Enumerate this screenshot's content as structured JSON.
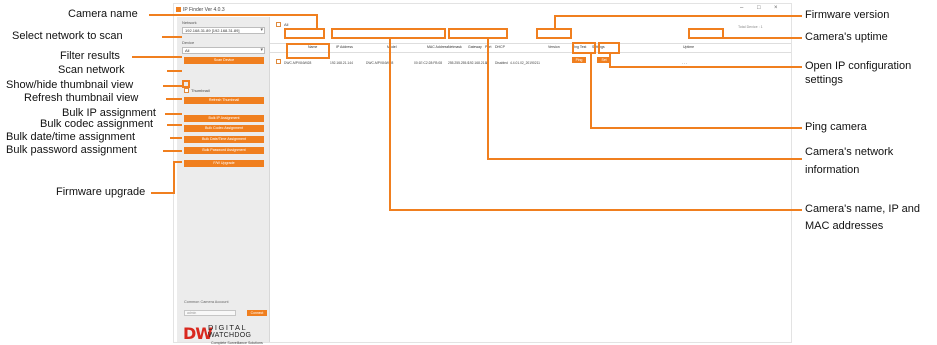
{
  "window": {
    "title": "IP Finder Ver 4.0.3",
    "controls": [
      "–",
      "□",
      "×"
    ]
  },
  "sidebar": {
    "network_label": "Network",
    "network_value": "192.168.31.89 [192.168.31.89]",
    "device_label": "Device",
    "device_value": "All",
    "scan_button": "Scan Device",
    "thumbnail_label": "Thumbnail",
    "refresh_button": "Refresh Thumbnail",
    "bulk_buttons": [
      "Bulk IP Assignment",
      "Bulk Codec Assignment",
      "Bulk Date/Time Assignment",
      "Bulk Password Assignment",
      "F/W Upgrade"
    ],
    "connect_label": "Common Camera Account",
    "connect_placeholder": "admin",
    "connect_button": "Connect",
    "logo": {
      "dw": "DW",
      "line1": "DIGITAL",
      "line2": "WATCHDOG",
      "tagline": "Complete Surveillance Solutions"
    }
  },
  "table": {
    "all_label": "All",
    "total_label": "Total Device : 1",
    "headers": [
      "Name",
      "IP Address",
      "Model",
      "MAC Address",
      "Netmask",
      "Gateway",
      "Port",
      "DHCP",
      "Version",
      "Ping Test",
      "Settings",
      "Uptime"
    ],
    "row": {
      "name": "DWC-MPV84Wi28",
      "ip": "192.168.21.144",
      "model": "DWC-MPV84Wi28",
      "mac": "00:1E:C2:28:FB:08",
      "netmask": "255.255.255.0",
      "gateway": "192.168.21.1",
      "port": "80",
      "dhcp": "Disabled",
      "version": "4.4.01.02_20190211",
      "ping": "Ping",
      "settings": "Set",
      "uptime": "- - -"
    }
  },
  "callouts": {
    "camera_name": "Camera  name",
    "select_network": "Select network to scan",
    "filter_results": "Filter results",
    "scan_network": "Scan network",
    "show_hide_thumb": "Show/hide thumbnail view",
    "refresh_thumb": "Refresh thumbnail view",
    "bulk_ip": "Bulk IP assignment",
    "bulk_codec": "Bulk codec assignment",
    "bulk_datetime": "Bulk date/time assignment",
    "bulk_password": "Bulk password assignment",
    "firmware_upgrade": "Firmware upgrade",
    "firmware_version": "Firmware version",
    "uptime": "Camera's uptime",
    "open_ip_1": "Open IP configuration",
    "open_ip_2": "settings",
    "ping": "Ping camera",
    "network_1": "Camera's network",
    "network_2": "information",
    "name_ip_mac_1": "Camera's name, IP and",
    "name_ip_mac_2": "MAC addresses"
  },
  "colors": {
    "accent": "#f07f1f",
    "logo_red": "#d9281e"
  }
}
